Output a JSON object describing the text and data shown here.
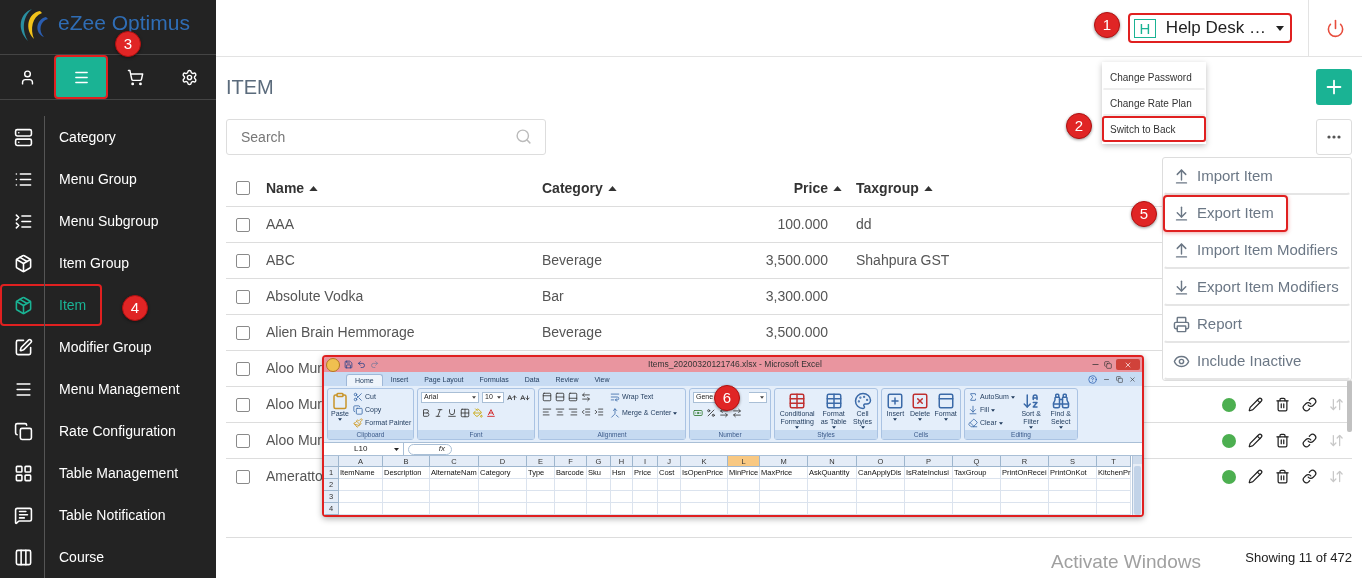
{
  "brand": {
    "name": "eZee Optimus"
  },
  "sidebar": {
    "tabs": [
      {
        "selected": false,
        "highlighted": false
      },
      {
        "selected": true,
        "highlighted": true
      },
      {
        "selected": false,
        "highlighted": false
      },
      {
        "selected": false,
        "highlighted": false
      }
    ],
    "items": [
      {
        "label": "Category",
        "selected": false,
        "highlighted": false
      },
      {
        "label": "Menu Group",
        "selected": false,
        "highlighted": false
      },
      {
        "label": "Menu Subgroup",
        "selected": false,
        "highlighted": false
      },
      {
        "label": "Item Group",
        "selected": false,
        "highlighted": false
      },
      {
        "label": "Item",
        "selected": true,
        "highlighted": true
      },
      {
        "label": "Modifier Group",
        "selected": false,
        "highlighted": false
      },
      {
        "label": "Menu Management",
        "selected": false,
        "highlighted": false
      },
      {
        "label": "Rate Configuration",
        "selected": false,
        "highlighted": false
      },
      {
        "label": "Table Management",
        "selected": false,
        "highlighted": false
      },
      {
        "label": "Table Notification",
        "selected": false,
        "highlighted": false
      },
      {
        "label": "Course",
        "selected": false,
        "highlighted": false
      }
    ]
  },
  "header": {
    "user": {
      "initial": "H",
      "label": "Help Desk …",
      "highlighted": true
    }
  },
  "user_menu": [
    {
      "label": "Change Password",
      "highlighted": false
    },
    {
      "label": "Change Rate Plan",
      "highlighted": false
    },
    {
      "label": "Switch to Back",
      "highlighted": true
    }
  ],
  "page": {
    "title": "ITEM",
    "search": {
      "placeholder": "Search"
    }
  },
  "table": {
    "select_all": false,
    "columns": [
      {
        "label": "Name"
      },
      {
        "label": "Category"
      },
      {
        "label": "Price"
      },
      {
        "label": "Taxgroup"
      }
    ],
    "rows": [
      {
        "checked": false,
        "name": "AAA",
        "category": "",
        "price": "100.000",
        "taxgroup": "dd"
      },
      {
        "checked": false,
        "name": "ABC",
        "category": "Beverage",
        "price": "3,500.000",
        "taxgroup": "Shahpura GST"
      },
      {
        "checked": false,
        "name": "Absolute Vodka",
        "category": "Bar",
        "price": "3,300.000",
        "taxgroup": ""
      },
      {
        "checked": false,
        "name": "Alien Brain Hemmorage",
        "category": "Beverage",
        "price": "3,500.000",
        "taxgroup": ""
      },
      {
        "checked": false,
        "name": "Aloo Mur",
        "category": "",
        "price": "",
        "taxgroup": ""
      },
      {
        "checked": false,
        "name": "Aloo Mur",
        "category": "",
        "price": "",
        "taxgroup": "",
        "active": true
      },
      {
        "checked": false,
        "name": "Aloo Mur",
        "category": "",
        "price": "",
        "taxgroup": "",
        "active": true
      },
      {
        "checked": false,
        "name": "Ameratto",
        "category": "",
        "price": "",
        "taxgroup": "",
        "active": true
      }
    ],
    "footer": "Showing 11 of 472"
  },
  "more_menu": [
    {
      "kind": "import",
      "label": "Import Item",
      "highlighted": false
    },
    {
      "kind": "export",
      "label": "Export Item",
      "highlighted": true
    },
    {
      "kind": "import",
      "label": "Import Item Modifiers",
      "highlighted": false
    },
    {
      "kind": "export",
      "label": "Export Item Modifiers",
      "highlighted": false
    },
    {
      "kind": "report",
      "label": "Report",
      "highlighted": false
    },
    {
      "kind": "view",
      "label": "Include Inactive",
      "highlighted": false
    }
  ],
  "excel": {
    "title": "Items_20200320121746.xlsx - Microsoft Excel",
    "highlighted": true,
    "tabs": [
      {
        "label": "Home",
        "selected": true
      },
      {
        "label": "Insert",
        "selected": false
      },
      {
        "label": "Page Layout",
        "selected": false
      },
      {
        "label": "Formulas",
        "selected": false
      },
      {
        "label": "Data",
        "selected": false
      },
      {
        "label": "Review",
        "selected": false
      },
      {
        "label": "View",
        "selected": false
      }
    ],
    "groups": [
      {
        "kind": "clipboard",
        "label": "Clipboard",
        "buttons": [
          "Paste",
          "Cut",
          "Copy",
          "Format Painter"
        ]
      },
      {
        "kind": "font",
        "label": "Font",
        "fields": [
          "Arial",
          "10"
        ]
      },
      {
        "kind": "alignment",
        "label": "Alignment",
        "buttons": [
          "Wrap Text",
          "Merge & Center"
        ]
      },
      {
        "kind": "number",
        "label": "Number",
        "fields": [
          "Gene"
        ]
      },
      {
        "kind": "styles",
        "label": "Styles",
        "buttons": [
          "Conditional Formatting",
          "Format as Table",
          "Cell Styles"
        ]
      },
      {
        "kind": "cells",
        "label": "Cells",
        "buttons": [
          "Insert",
          "Delete",
          "Format"
        ]
      },
      {
        "kind": "editing",
        "label": "Editing",
        "buttons": [
          "AutoSum",
          "Fill",
          "Clear",
          "Sort & Filter",
          "Find & Select"
        ]
      }
    ],
    "name_box": "L10",
    "formula_label": "fx",
    "columns": [
      {
        "letter": "A",
        "selected": false
      },
      {
        "letter": "B",
        "selected": false
      },
      {
        "letter": "C",
        "selected": false
      },
      {
        "letter": "D",
        "selected": false
      },
      {
        "letter": "E",
        "selected": false
      },
      {
        "letter": "F",
        "selected": false
      },
      {
        "letter": "G",
        "selected": false
      },
      {
        "letter": "H",
        "selected": false
      },
      {
        "letter": "I",
        "selected": false
      },
      {
        "letter": "J",
        "selected": false
      },
      {
        "letter": "K",
        "selected": false
      },
      {
        "letter": "L",
        "selected": true
      },
      {
        "letter": "M",
        "selected": false
      },
      {
        "letter": "N",
        "selected": false
      },
      {
        "letter": "O",
        "selected": false
      },
      {
        "letter": "P",
        "selected": false
      },
      {
        "letter": "Q",
        "selected": false
      },
      {
        "letter": "R",
        "selected": false
      },
      {
        "letter": "S",
        "selected": false
      },
      {
        "letter": "T",
        "selected": false
      }
    ],
    "rows": [
      {
        "number": "1",
        "cells": [
          "ItemName",
          "Description",
          "AlternateNam",
          "Category",
          "Type",
          "Barcode",
          "Sku",
          "Hsn",
          "Price",
          "Cost",
          "IsOpenPrice",
          "MinPrice",
          "MaxPrice",
          "AskQuantity",
          "CanApplyDis",
          "IsRateInclusi",
          "TaxGroup",
          "PrintOnRecei",
          "PrintOnKot",
          "KitchenPr"
        ]
      },
      {
        "number": "2",
        "cells": []
      },
      {
        "number": "3",
        "cells": []
      },
      {
        "number": "4",
        "cells": []
      }
    ]
  },
  "badges": [
    {
      "number": "1"
    },
    {
      "number": "2"
    },
    {
      "number": "3"
    },
    {
      "number": "4"
    },
    {
      "number": "5"
    },
    {
      "number": "6"
    }
  ],
  "os_notice": "Activate Windows"
}
